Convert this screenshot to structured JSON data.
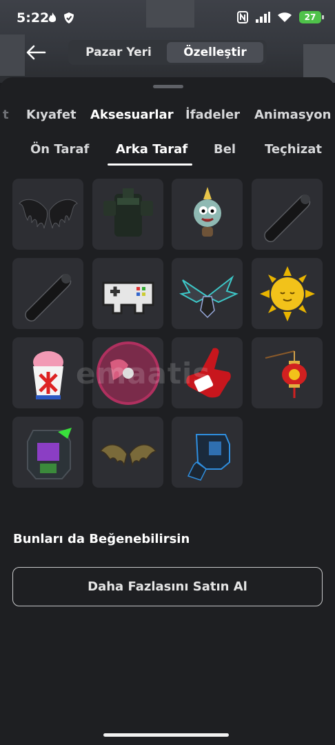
{
  "status": {
    "time": "5:22",
    "battery": "27"
  },
  "topbar": {
    "tabs": [
      "Pazar Yeri",
      "Özelleştir"
    ],
    "active_tab": "Özelleştir"
  },
  "categories": {
    "edge_left": "t",
    "items": [
      "Kıyafet",
      "Aksesuarlar",
      "İfadeler",
      "Animasyon"
    ],
    "active": "Aksesuarlar"
  },
  "subcategories": {
    "items": [
      "Ön Taraf",
      "Arka Taraf",
      "Bel",
      "Teçhizat"
    ],
    "active": "Arka Taraf"
  },
  "items": [
    {
      "icon": "dark-wings-icon"
    },
    {
      "icon": "green-backpack-icon"
    },
    {
      "icon": "party-character-icon"
    },
    {
      "icon": "black-tube-icon"
    },
    {
      "icon": "black-tube-icon"
    },
    {
      "icon": "pixel-gamepad-icon"
    },
    {
      "icon": "mech-dragon-icon"
    },
    {
      "icon": "sun-icon"
    },
    {
      "icon": "snow-cone-icon"
    },
    {
      "icon": "record-disc-icon"
    },
    {
      "icon": "foam-finger-icon"
    },
    {
      "icon": "red-lantern-icon"
    },
    {
      "icon": "robot-backpack-icon"
    },
    {
      "icon": "bat-wings-icon"
    },
    {
      "icon": "blue-armor-icon"
    }
  ],
  "suggestions_title": "Bunları da Beğenebilirsin",
  "buy_more_label": "Daha Fazlasını Satın Al",
  "watermark": "emaatis"
}
